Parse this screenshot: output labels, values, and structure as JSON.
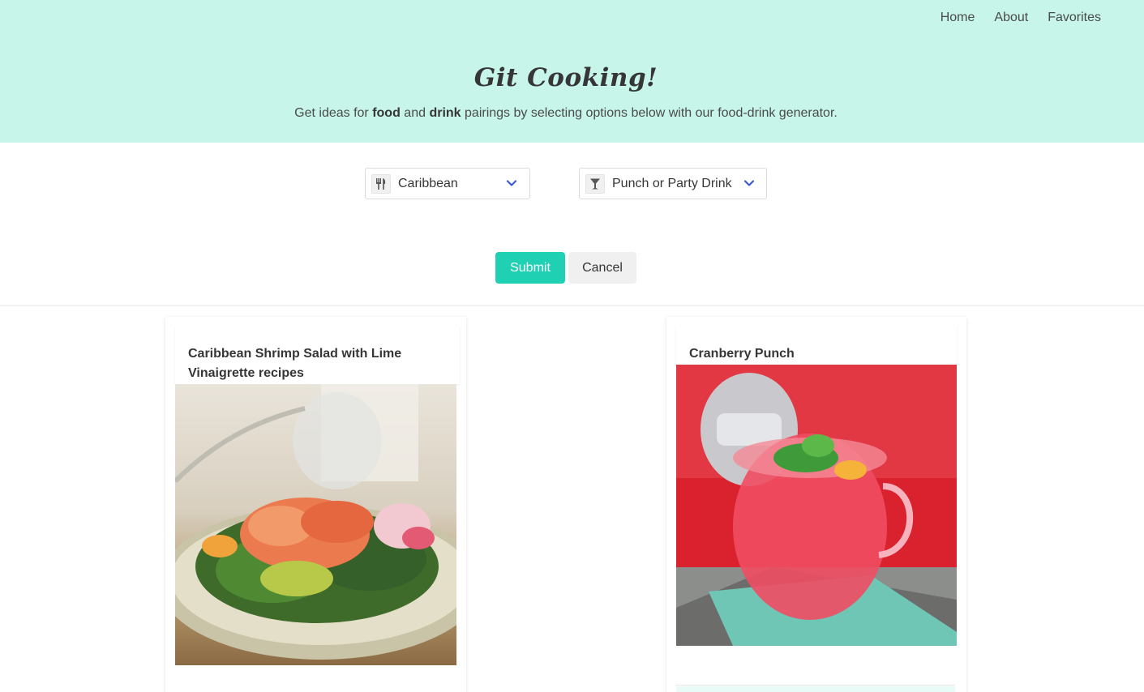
{
  "nav": {
    "links": [
      "Home",
      "About",
      "Favorites"
    ]
  },
  "hero": {
    "title": "Git Cooking!",
    "subtitle_prefix": "Get ideas for ",
    "subtitle_food": "food",
    "subtitle_and": " and ",
    "subtitle_drink": "drink",
    "subtitle_suffix": " pairings by selecting options below with our food-drink generator."
  },
  "form": {
    "food_select": {
      "value": "Caribbean",
      "icon": "utensils-icon"
    },
    "drink_select": {
      "value": "Punch or Party Drink",
      "icon": "cocktail-glass-icon"
    },
    "submit_label": "Submit",
    "cancel_label": "Cancel"
  },
  "results": {
    "food_card": {
      "title": "Caribbean Shrimp Salad with Lime Vinaigrette recipes",
      "image": "shrimp-salad-photo"
    },
    "drink_card": {
      "title": "Cranberry Punch",
      "image": "cranberry-punch-photo"
    }
  },
  "colors": {
    "hero_bg": "#c7f5ea",
    "primary": "#1fd1b2",
    "chevron": "#3b5bd6"
  }
}
